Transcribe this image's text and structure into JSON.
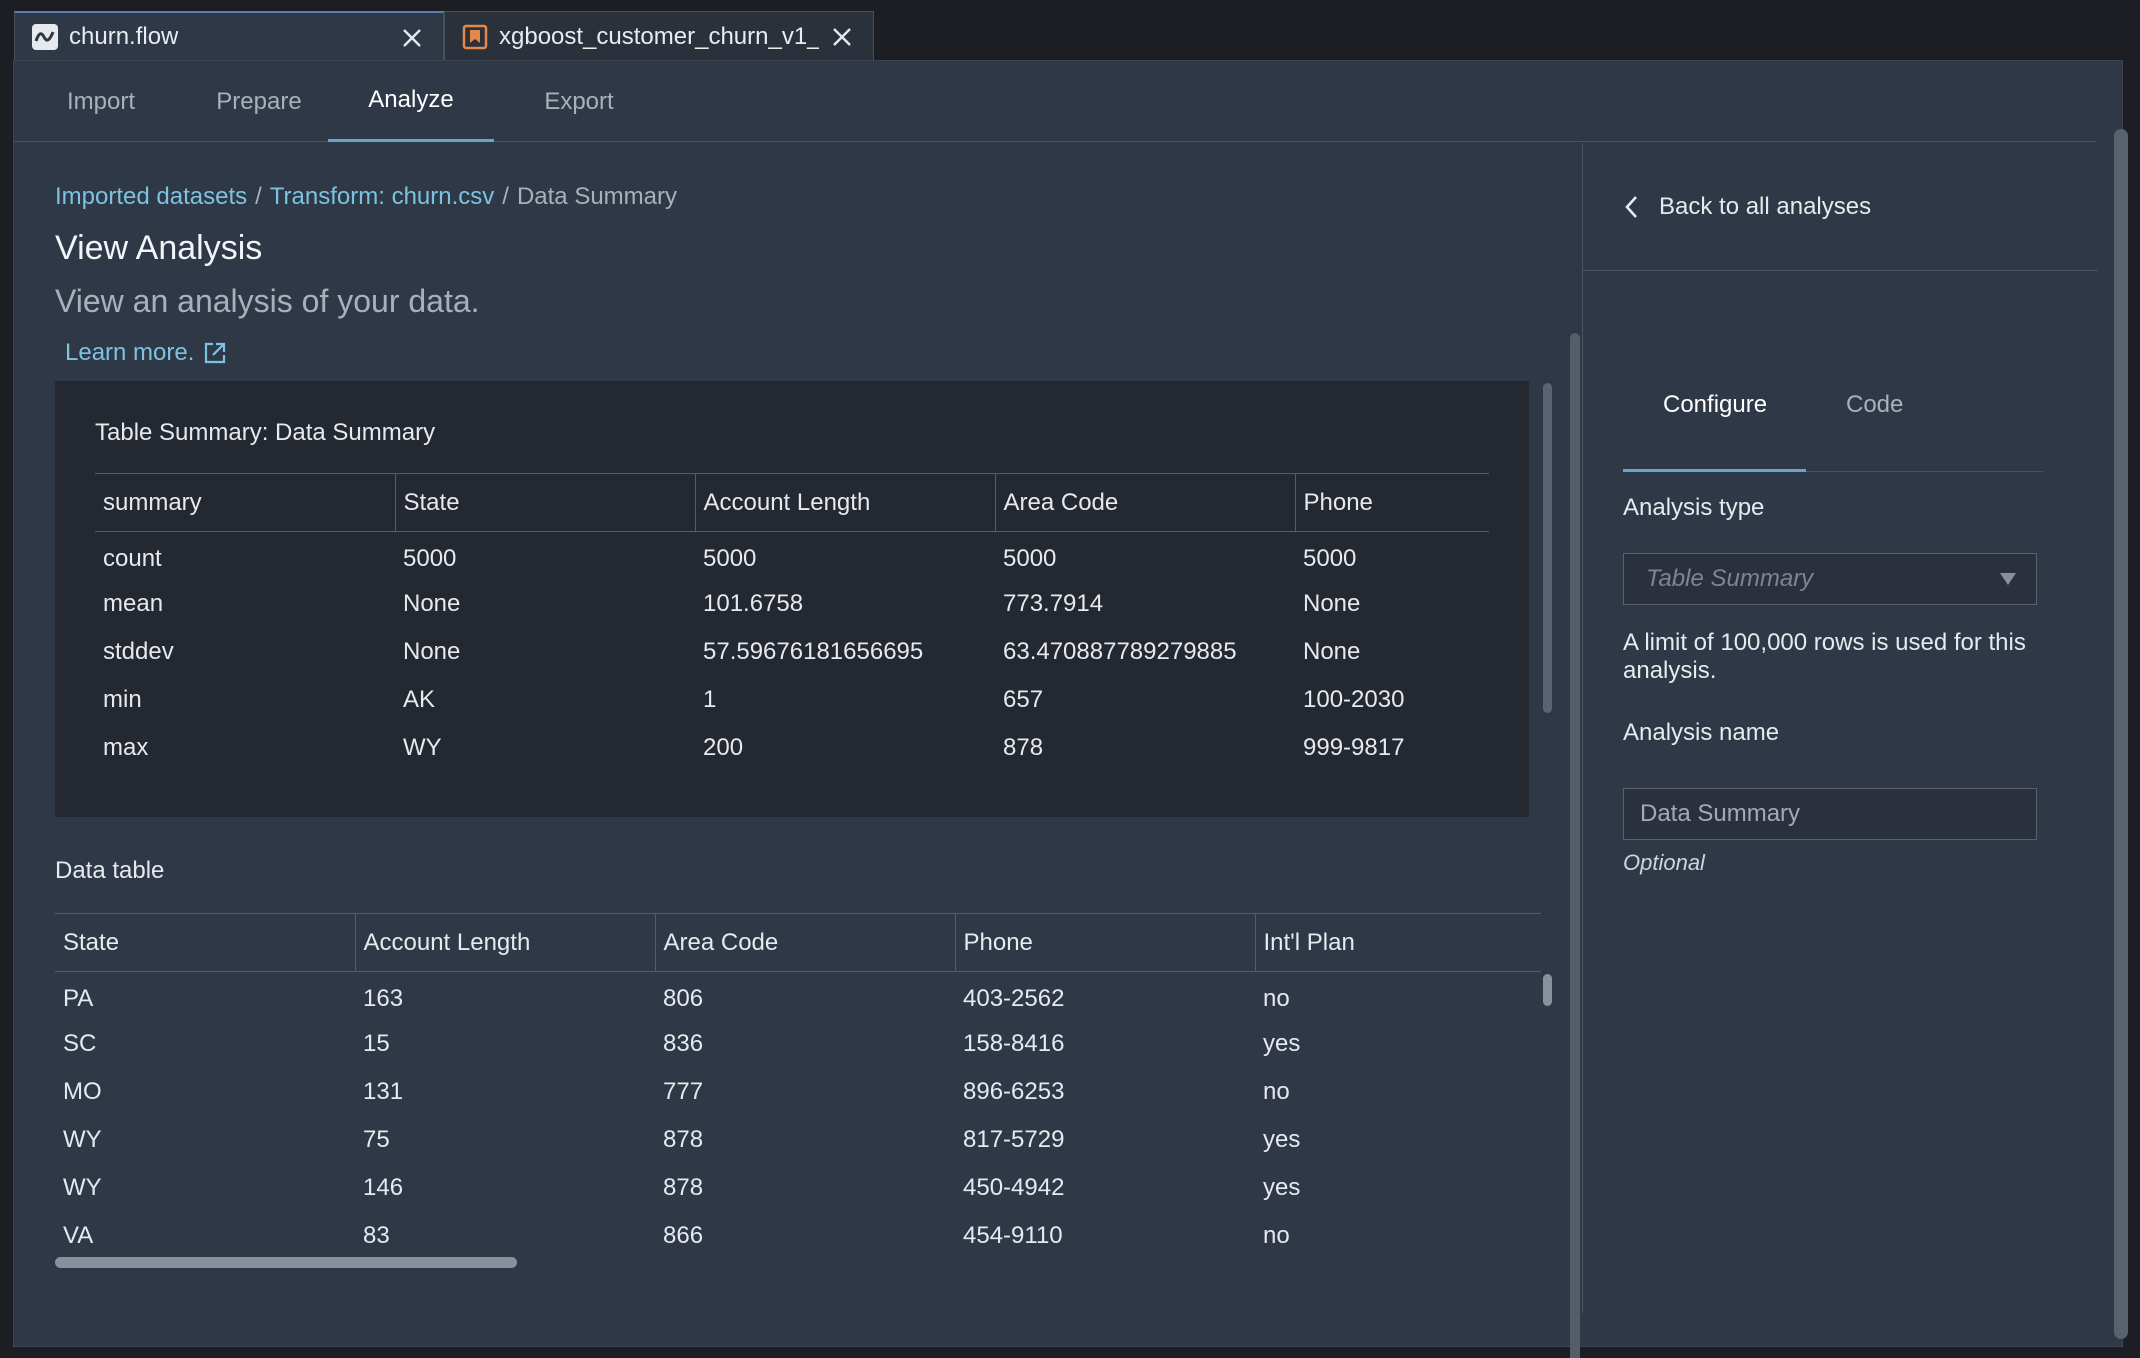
{
  "file_tabs": [
    {
      "title": "churn.flow",
      "icon": "flow-icon"
    },
    {
      "title": "xgboost_customer_churn_v1_",
      "icon": "bookmark-icon"
    }
  ],
  "nav_tabs": [
    "Import",
    "Prepare",
    "Analyze",
    "Export"
  ],
  "active_nav_tab": "Analyze",
  "breadcrumb": {
    "items": [
      "Imported datasets",
      "Transform: churn.csv",
      "Data Summary"
    ],
    "separator": "/"
  },
  "page": {
    "title": "View Analysis",
    "subtitle": "View an analysis of your data.",
    "learn_more": "Learn more."
  },
  "summary": {
    "title": "Table Summary: Data Summary",
    "columns": [
      "summary",
      "State",
      "Account Length",
      "Area Code",
      "Phone"
    ],
    "rows": [
      [
        "count",
        "5000",
        "5000",
        "5000",
        "5000"
      ],
      [
        "mean",
        "None",
        "101.6758",
        "773.7914",
        "None"
      ],
      [
        "stddev",
        "None",
        "57.59676181656695",
        "63.470887789279885",
        "None"
      ],
      [
        "min",
        "AK",
        "1",
        "657",
        "100-2030"
      ],
      [
        "max",
        "WY",
        "200",
        "878",
        "999-9817"
      ]
    ]
  },
  "data_table": {
    "label": "Data table",
    "columns": [
      "State",
      "Account Length",
      "Area Code",
      "Phone",
      "Int'l Plan"
    ],
    "rows": [
      [
        "PA",
        "163",
        "806",
        "403-2562",
        "no"
      ],
      [
        "SC",
        "15",
        "836",
        "158-8416",
        "yes"
      ],
      [
        "MO",
        "131",
        "777",
        "896-6253",
        "no"
      ],
      [
        "WY",
        "75",
        "878",
        "817-5729",
        "yes"
      ],
      [
        "WY",
        "146",
        "878",
        "450-4942",
        "yes"
      ],
      [
        "VA",
        "83",
        "866",
        "454-9110",
        "no"
      ]
    ]
  },
  "right_panel": {
    "back_label": "Back to all analyses",
    "tabs": [
      "Configure",
      "Code"
    ],
    "active_tab": "Configure",
    "analysis_type_label": "Analysis type",
    "analysis_type_value": "Table Summary",
    "note": "A limit of 100,000 rows is used for this analysis.",
    "analysis_name_label": "Analysis name",
    "analysis_name_value": "Data Summary",
    "optional_hint": "Optional"
  },
  "colors": {
    "accent": "#6aa4c8",
    "link": "#7cc3e0",
    "panel_bg": "#2f3846",
    "summary_bg": "#232831"
  }
}
